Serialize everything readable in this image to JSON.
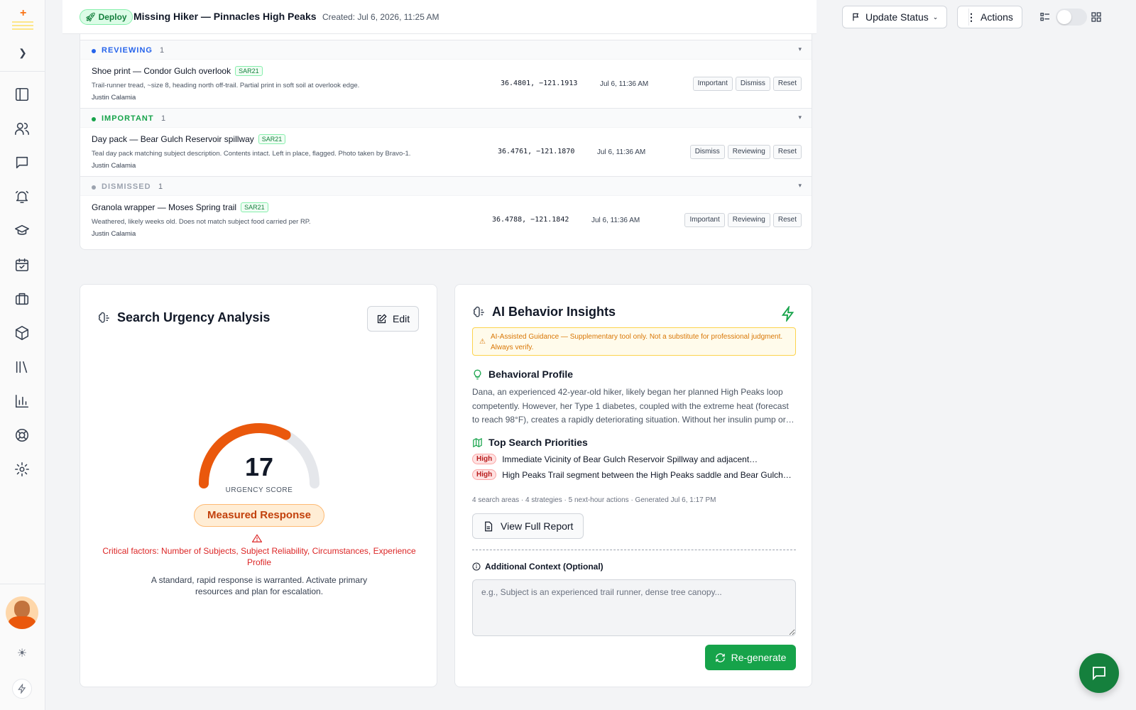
{
  "header": {
    "deploy_label": "Deploy",
    "incident_title": "Missing Hiker — Pinnacles High Peaks",
    "created": "Created: Jul 6, 2026, 11:25 AM",
    "update_status_label": "Update Status",
    "actions_label": "Actions"
  },
  "clue_groups": [
    {
      "name": "REVIEWING",
      "count": "1",
      "color": "#2563eb",
      "clue": {
        "title": "Shoe print — Condor Gulch overlook",
        "tag": "SAR21",
        "description": "Trail-runner tread, ~size 8, heading north off-trail. Partial print in soft soil at overlook edge.",
        "author": "Justin Calamia",
        "coords": "36.4801, −121.1913",
        "time": "Jul 6, 11:36 AM",
        "actions": [
          "Important",
          "Dismiss",
          "Reset"
        ]
      }
    },
    {
      "name": "IMPORTANT",
      "count": "1",
      "color": "#16a34a",
      "clue": {
        "title": "Day pack — Bear Gulch Reservoir spillway",
        "tag": "SAR21",
        "description": "Teal day pack matching subject description. Contents intact. Left in place, flagged. Photo taken by Bravo-1.",
        "author": "Justin Calamia",
        "coords": "36.4761, −121.1870",
        "time": "Jul 6, 11:36 AM",
        "actions": [
          "Dismiss",
          "Reviewing",
          "Reset"
        ]
      }
    },
    {
      "name": "DISMISSED",
      "count": "1",
      "color": "#9ca3af",
      "clue": {
        "title": "Granola wrapper — Moses Spring trail",
        "tag": "SAR21",
        "description": "Weathered, likely weeks old. Does not match subject food carried per RP.",
        "author": "Justin Calamia",
        "coords": "36.4788, −121.1842",
        "time": "Jul 6, 11:36 AM",
        "actions": [
          "Important",
          "Reviewing",
          "Reset"
        ]
      }
    }
  ],
  "urgency": {
    "title": "Search Urgency Analysis",
    "edit_label": "Edit",
    "score": 17,
    "score_label": "URGENCY SCORE",
    "gauge_fraction": 0.66,
    "response_level": "Measured Response",
    "critical_factors": "Critical factors: Number of Subjects, Subject Reliability, Circumstances, Experience Profile",
    "description": "A standard, rapid response is warranted. Activate primary resources and plan for escalation."
  },
  "ai": {
    "title": "AI Behavior Insights",
    "disclaimer": "AI-Assisted Guidance — Supplementary tool only. Not a substitute for professional judgment. Always verify.",
    "profile_heading": "Behavioral Profile",
    "profile_text": "Dana, an experienced 42-year-old hiker, likely began her planned High Peaks loop competently. However, her Type 1 diabetes, coupled with the extreme heat (forecast to reach 98°F), creates a rapidly deteriorating situation. Without her insulin pump or…",
    "priorities_heading": "Top Search Priorities",
    "priorities": [
      {
        "level": "High",
        "text": "Immediate Vicinity of Bear Gulch Reservoir Spillway and adjacent…"
      },
      {
        "level": "High",
        "text": "High Peaks Trail segment between the High Peaks saddle and Bear Gulch…"
      }
    ],
    "meta": "4 search areas · 4 strategies · 5 next-hour actions · Generated Jul 6, 1:17 PM",
    "report_label": "View Full Report",
    "context_label": "Additional Context (Optional)",
    "context_placeholder": "e.g., Subject is an experienced trail runner, dense tree canopy...",
    "regenerate_label": "Re-generate"
  },
  "colors": {
    "accent_green": "#16a34a",
    "gauge_orange": "#ea580c",
    "gauge_track": "#e5e7eb"
  }
}
